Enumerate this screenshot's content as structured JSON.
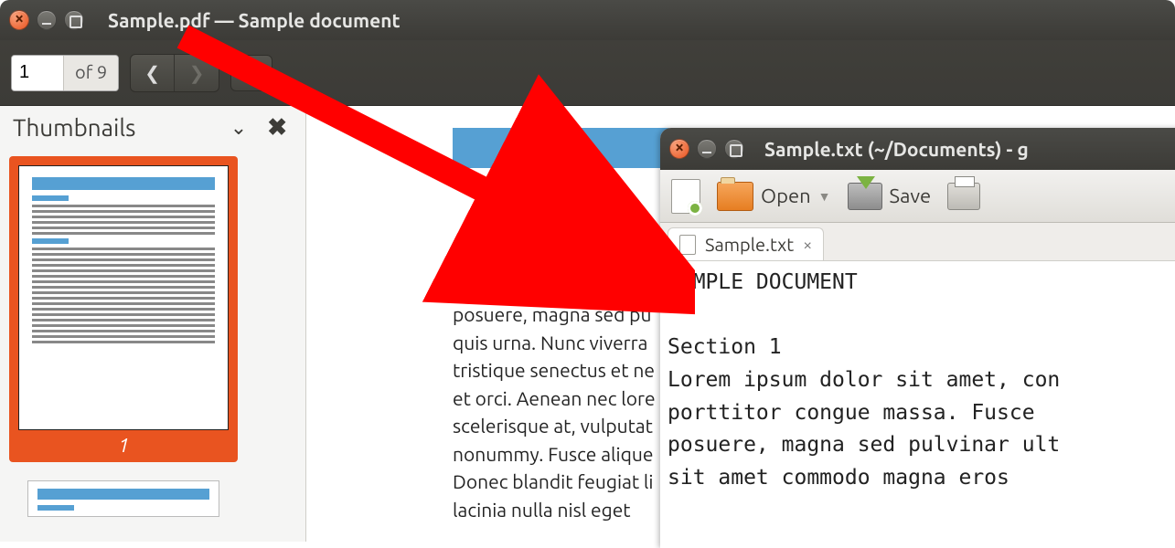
{
  "pdf": {
    "title": "Sample.pdf — Sample document",
    "page_current": "1",
    "page_total_label": "of 9",
    "sidebar_title": "Thumbnails",
    "thumb1_number": "1",
    "section_heading": "Section 1",
    "body_text": "Lorem ipsum dolor sit a\nposuere, magna sed pu\nquis urna. Nunc viverra\ntristique senectus et ne\net orci. Aenean nec lore\nscelerisque at, vulputat\nnonummy. Fusce alique\nDonec blandit feugiat li\nlacinia nulla nisl eget"
  },
  "txt": {
    "title": "Sample.txt (~/Documents) - g",
    "open_label": "Open",
    "save_label": "Save",
    "tab_label": "Sample.txt",
    "content": "SAMPLE DOCUMENT\n\nSection 1\nLorem ipsum dolor sit amet, con\nporttitor congue massa. Fusce\nposuere, magna sed pulvinar ult\nsit amet commodo magna eros"
  }
}
